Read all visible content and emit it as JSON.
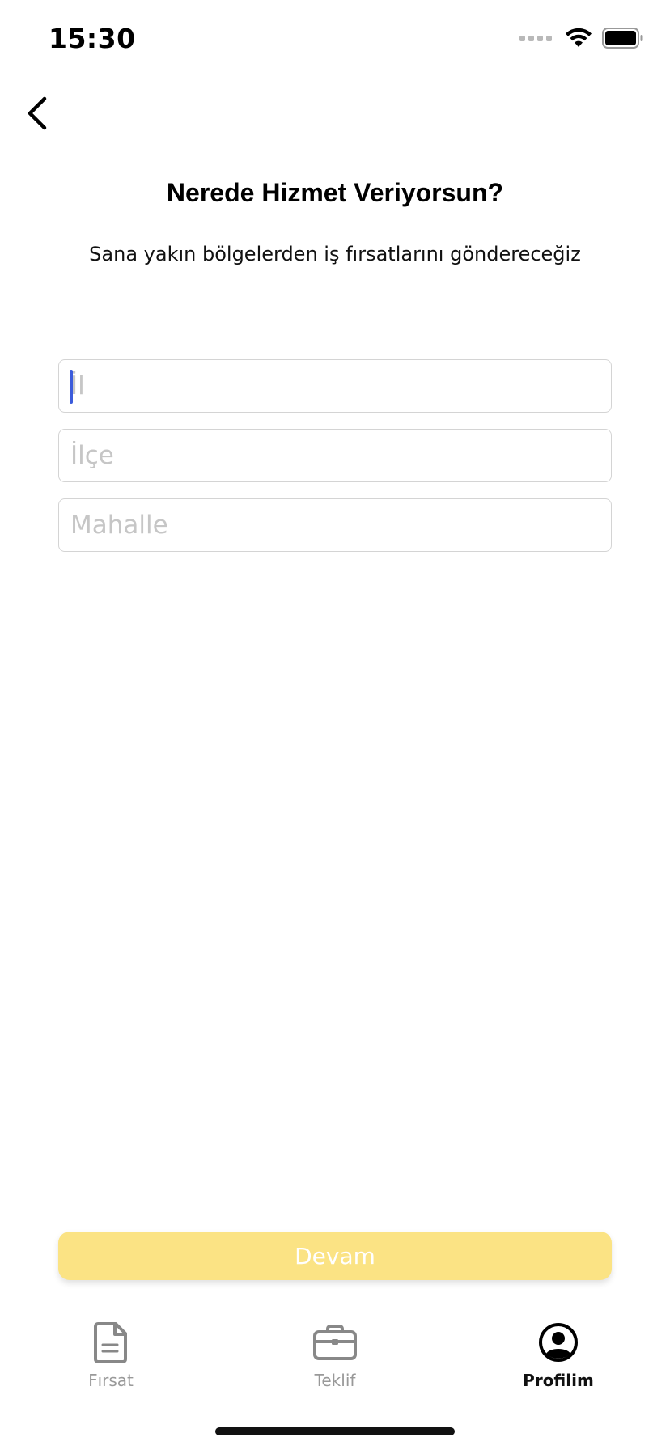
{
  "status_bar": {
    "time": "15:30"
  },
  "header": {
    "back_icon": "chevron-left-icon"
  },
  "page": {
    "title": "Nerede Hizmet Veriyorsun?",
    "subtitle": "Sana yakın bölgelerden iş fırsatlarını göndereceğiz"
  },
  "form": {
    "il": {
      "placeholder": "İl",
      "value": ""
    },
    "ilce": {
      "placeholder": "İlçe",
      "value": ""
    },
    "mahalle": {
      "placeholder": "Mahalle",
      "value": ""
    }
  },
  "actions": {
    "continue_label": "Devam",
    "continue_color": "#fbe384"
  },
  "tab_bar": {
    "tabs": [
      {
        "label": "Fırsat",
        "icon": "document-icon",
        "active": false
      },
      {
        "label": "Teklif",
        "icon": "briefcase-icon",
        "active": false
      },
      {
        "label": "Profilim",
        "icon": "user-circle-icon",
        "active": true
      }
    ]
  },
  "colors": {
    "accent": "#3b5bdb",
    "inactive_tab": "#999999",
    "active_tab": "#111111"
  }
}
